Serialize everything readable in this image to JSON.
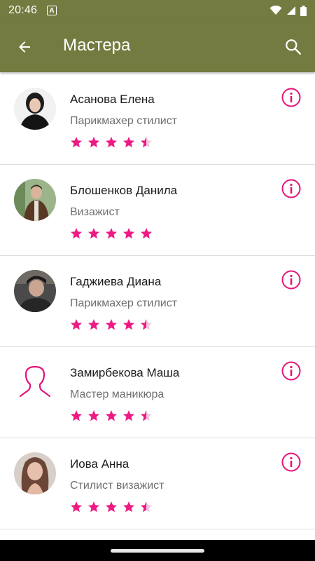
{
  "status_bar": {
    "time": "20:46",
    "badge": "A"
  },
  "app_bar": {
    "title": "Мастера"
  },
  "colors": {
    "app_bar": "#737b40",
    "accent": "#e3147a",
    "star": "#ee1a84"
  },
  "masters": [
    {
      "name": "Асанова Елена",
      "role": "Парикмахер стилист",
      "rating": 4.5
    },
    {
      "name": "Блошенков Данила",
      "role": "Визажист",
      "rating": 5
    },
    {
      "name": "Гаджиева Диана",
      "role": "Парикмахер стилист",
      "rating": 4.5
    },
    {
      "name": "Замирбекова Маша",
      "role": "Мастер маникюра",
      "rating": 4.5
    },
    {
      "name": "Иова Анна",
      "role": "Стилист визажист",
      "rating": 4.5
    }
  ]
}
